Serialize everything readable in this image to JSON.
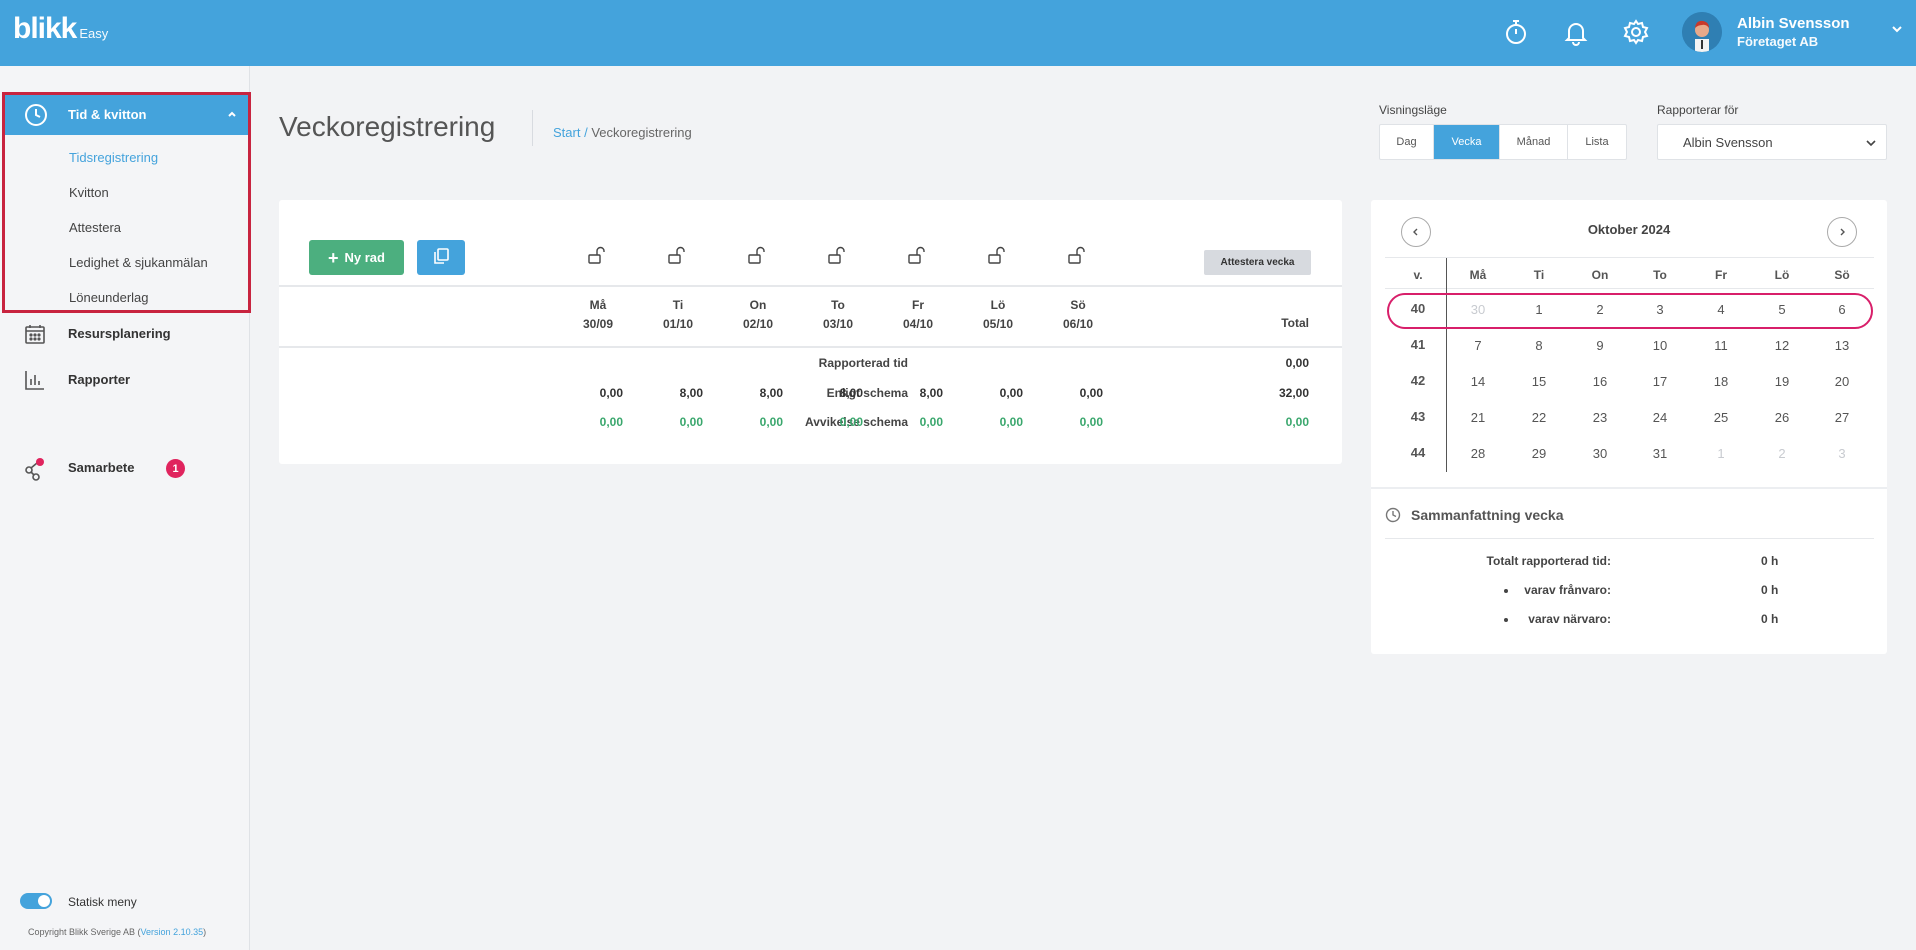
{
  "header": {
    "logo": "blikk",
    "logo_sub": "Easy",
    "user_name": "Albin Svensson",
    "user_company": "Företaget AB",
    "icons": [
      "stopwatch-icon",
      "bell-icon",
      "gear-icon",
      "chevron-down-icon"
    ],
    "colors": {
      "brand": "#44a3dc",
      "badge": "#e0245e",
      "positive": "#3aa76d",
      "highlight": "#c8243f"
    }
  },
  "sidebar": {
    "active_section": "Tid & kvitton",
    "sub_items": [
      "Tidsregistrering",
      "Kvitton",
      "Attestera",
      "Ledighet & sjukanmälan",
      "Löneunderlag"
    ],
    "items": [
      {
        "label": "Resursplanering",
        "icon": "calendar-icon"
      },
      {
        "label": "Rapporter",
        "icon": "bar-chart-icon"
      },
      {
        "label": "Samarbete",
        "icon": "share-icon",
        "badge": "1"
      }
    ],
    "toggle_label": "Statisk meny",
    "copyright": "Copyright Blikk Sverige AB (",
    "version": "Version 2.10.35",
    "copyright_end": ")"
  },
  "page": {
    "title": "Veckoregistrering",
    "breadcrumb_start": "Start",
    "breadcrumb_sep": " / ",
    "breadcrumb_current": "Veckoregistrering"
  },
  "view_mode": {
    "label": "Visningsläge",
    "options": [
      "Dag",
      "Vecka",
      "Månad",
      "Lista"
    ],
    "selected": "Vecka"
  },
  "reports_for": {
    "label": "Rapporterar för",
    "value": "Albin Svensson"
  },
  "week_table": {
    "new_row_label": "Ny rad",
    "attest_label": "Attestera vecka",
    "days": [
      {
        "name": "Må",
        "date": "30/09"
      },
      {
        "name": "Ti",
        "date": "01/10"
      },
      {
        "name": "On",
        "date": "02/10"
      },
      {
        "name": "To",
        "date": "03/10"
      },
      {
        "name": "Fr",
        "date": "04/10"
      },
      {
        "name": "Lö",
        "date": "05/10"
      },
      {
        "name": "Sö",
        "date": "06/10"
      }
    ],
    "total_header": "Total",
    "rows": [
      {
        "label": "Rapporterad tid",
        "values": [
          "",
          "",
          "",
          "",
          "",
          "",
          ""
        ],
        "total": "0,00",
        "green": false
      },
      {
        "label": "Enligt schema",
        "values": [
          "0,00",
          "8,00",
          "8,00",
          "8,00",
          "8,00",
          "0,00",
          "0,00"
        ],
        "total": "32,00",
        "green": false
      },
      {
        "label": "Avvikelse schema",
        "values": [
          "0,00",
          "0,00",
          "0,00",
          "0,00",
          "0,00",
          "0,00",
          "0,00"
        ],
        "total": "0,00",
        "green": true
      }
    ]
  },
  "calendar": {
    "month": "Oktober 2024",
    "week_header": "v.",
    "day_headers": [
      "Må",
      "Ti",
      "On",
      "To",
      "Fr",
      "Lö",
      "Sö"
    ],
    "weeks": [
      {
        "week": "40",
        "days": [
          "30",
          "1",
          "2",
          "3",
          "4",
          "5",
          "6"
        ],
        "muted": [
          true,
          false,
          false,
          false,
          false,
          false,
          false
        ]
      },
      {
        "week": "41",
        "days": [
          "7",
          "8",
          "9",
          "10",
          "11",
          "12",
          "13"
        ],
        "muted": [
          false,
          false,
          false,
          false,
          false,
          false,
          false
        ]
      },
      {
        "week": "42",
        "days": [
          "14",
          "15",
          "16",
          "17",
          "18",
          "19",
          "20"
        ],
        "muted": [
          false,
          false,
          false,
          false,
          false,
          false,
          false
        ]
      },
      {
        "week": "43",
        "days": [
          "21",
          "22",
          "23",
          "24",
          "25",
          "26",
          "27"
        ],
        "muted": [
          false,
          false,
          false,
          false,
          false,
          false,
          false
        ]
      },
      {
        "week": "44",
        "days": [
          "28",
          "29",
          "30",
          "31",
          "1",
          "2",
          "3"
        ],
        "muted": [
          false,
          false,
          false,
          false,
          true,
          true,
          true
        ]
      }
    ],
    "selected_week": "40"
  },
  "summary": {
    "title": "Sammanfattning vecka",
    "rows": [
      {
        "label": "Totalt rapporterad tid:",
        "value": "0 h",
        "bullet": false
      },
      {
        "label": "varav frånvaro:",
        "value": "0 h",
        "bullet": true
      },
      {
        "label": "varav närvaro:",
        "value": "0 h",
        "bullet": true
      }
    ]
  }
}
